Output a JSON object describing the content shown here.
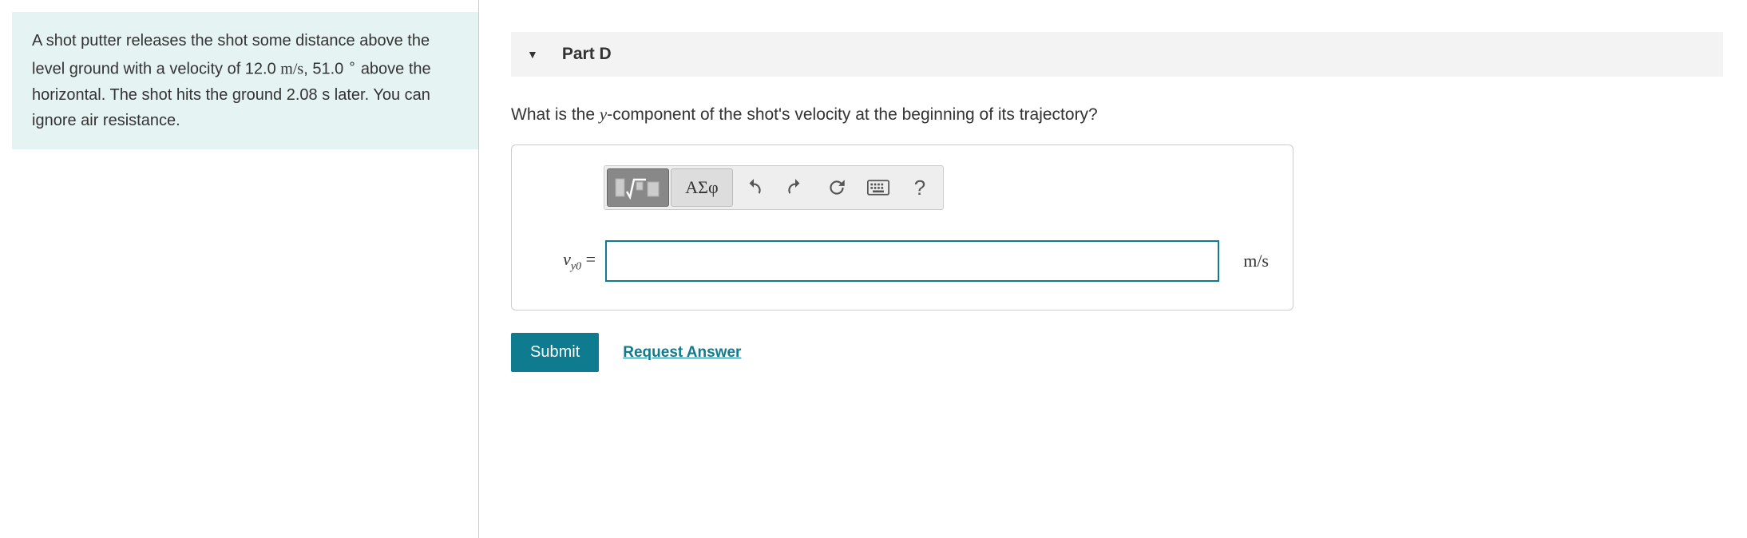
{
  "problem": {
    "text_before_velocity": "A shot putter releases the shot some distance above the level ground with a velocity of 12.0 ",
    "velocity_unit": "m/s",
    "text_mid": ", 51.0 ",
    "degree": "∘",
    "text_after": "above the horizontal. The shot hits the ground 2.08 s later. You can ignore air resistance."
  },
  "part": {
    "label": "Part D"
  },
  "question": {
    "before_y": "What is the ",
    "y_var": "y",
    "after_y": "-component of the shot's velocity at the beginning of its trajectory?"
  },
  "toolbar": {
    "greek": "ΑΣφ"
  },
  "input": {
    "var": "v",
    "sub": "y0",
    "eq": " = ",
    "value": "",
    "unit": "m/s"
  },
  "actions": {
    "submit": "Submit",
    "request": "Request Answer"
  }
}
